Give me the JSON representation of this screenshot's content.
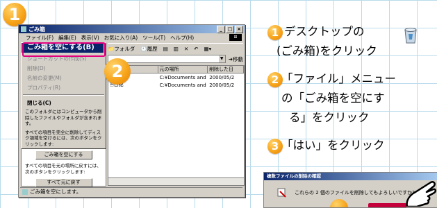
{
  "window": {
    "title": "ごみ箱",
    "title_buttons": [
      "_",
      "□",
      "×"
    ],
    "menubar": [
      "ファイル(F)",
      "編集(E)",
      "表示(V)",
      "お気に入り(A)",
      "ツール(T)",
      "ヘルプ(H)"
    ],
    "toolbar": [
      "フォルダ",
      "履歴"
    ],
    "address_go": "移動",
    "columns": [
      "元の場所",
      "削除した日"
    ],
    "files": [
      {
        "name": "",
        "location": "C:¥Documents and ...",
        "date": "2000/05/2"
      },
      {
        "name": "日記",
        "location": "C:¥Documents and ...",
        "date": "2000/05/2"
      }
    ],
    "status": "ごみ箱を空にします。"
  },
  "file_menu": {
    "highlighted": "ごみ箱を空にする(B)",
    "disabled_items": [
      "ショートカットの作成(S)",
      "削除(D)",
      "名前の変更(M)",
      "プロパティ(R)"
    ],
    "close": "閉じる(C)",
    "desc1": "このフォルダにはコンピュータから削除したファイルやフォルダが含まれます。",
    "desc2": "すべての項目を完全に削除してディスク領域を空けるには、次のボタンをクリックします:",
    "empty_button": "ごみ箱を空にする",
    "desc3": "すべての項目を元の場所に戻すには、次のボタンをクリックします:",
    "restore_button": "すべて元に戻す"
  },
  "steps": [
    {
      "num": "1",
      "line1": "デスクトップの",
      "line2": "(ごみ箱)をクリック"
    },
    {
      "num": "2",
      "line1": "「ファイル」メニュー",
      "line2": "の「ごみ箱を空にす",
      "line3": "る」をクリック"
    },
    {
      "num": "3",
      "line1": "「はい」をクリック"
    }
  ],
  "dialog": {
    "title": "複数ファイルの削除の確認",
    "message": "これらの 2 個のファイルを削除してもよろしいですか?"
  },
  "colors": {
    "accent": "#f7a51c",
    "highlight": "#0a246a",
    "callout": "#e3007f",
    "grid": "#b9dbec"
  }
}
